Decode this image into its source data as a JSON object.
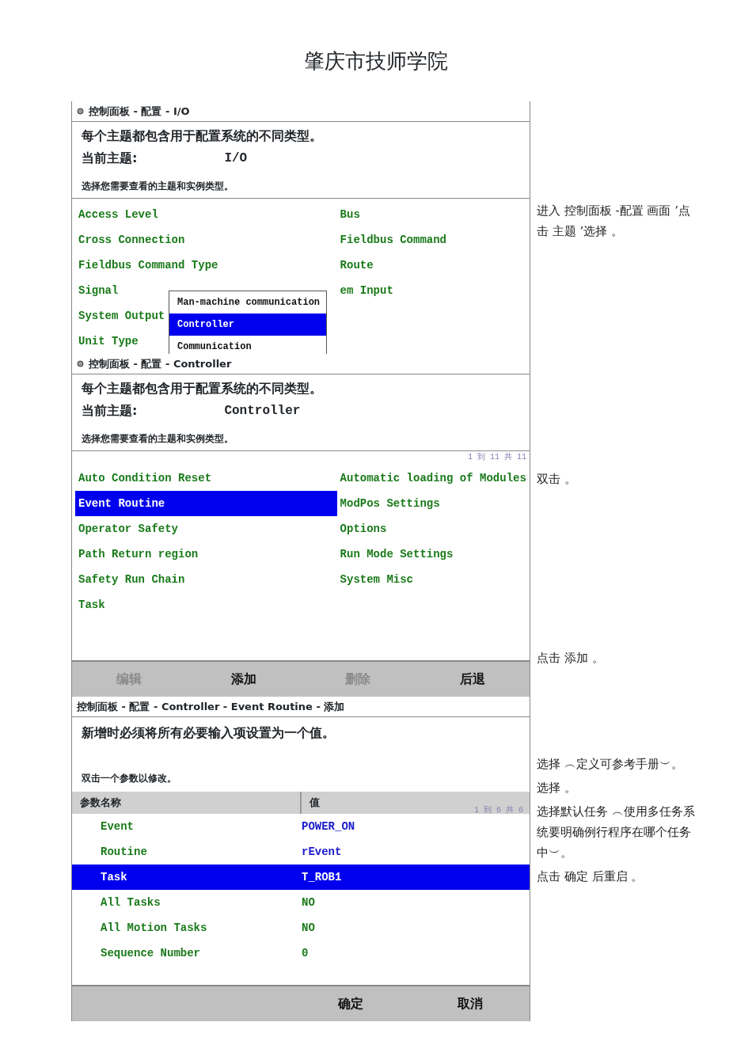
{
  "page_header": "肇庆市技师学院",
  "screens": [
    {
      "kind": "topics",
      "title": "控制面板 - 配置 - I/O",
      "intro": "每个主题都包含用于配置系统的不同类型。",
      "current_label": "当前主题:",
      "current_value": "I/O",
      "prompt": "选择您需要查看的主题和实例类型。",
      "columns": [
        [
          {
            "label": "Access Level",
            "selected": false
          },
          {
            "label": "Cross Connection",
            "selected": false
          },
          {
            "label": "Fieldbus Command Type",
            "selected": false
          },
          {
            "label": "Signal",
            "selected": false
          },
          {
            "label": "System Output",
            "selected": false
          },
          {
            "label": "Unit Type",
            "selected": false
          }
        ],
        [
          {
            "label": "Bus",
            "selected": false
          },
          {
            "label": "Fieldbus Command",
            "selected": false
          },
          {
            "label": "Route",
            "selected": false
          },
          {
            "label": "em Input",
            "selected": false
          }
        ]
      ],
      "popup": [
        {
          "label": "Man-machine communication",
          "selected": false
        },
        {
          "label": "Controller",
          "selected": true
        },
        {
          "label": "Communication",
          "selected": false
        }
      ],
      "notes": [
        "进入 控制面板 -配置 画面 ’点击 主题 ’选择 。"
      ]
    },
    {
      "kind": "topics",
      "title": "控制面板 - 配置 - Controller",
      "intro": "每个主题都包含用于配置系统的不同类型。",
      "current_label": "当前主题:",
      "current_value": "Controller",
      "prompt": "选择您需要查看的主题和实例类型。",
      "pagination": "1 到 11 共 11",
      "columns": [
        [
          {
            "label": "Auto Condition Reset",
            "selected": false
          },
          {
            "label": "Event Routine",
            "selected": true
          },
          {
            "label": "Operator Safety",
            "selected": false
          },
          {
            "label": "Path Return region",
            "selected": false
          },
          {
            "label": "Safety Run Chain",
            "selected": false
          },
          {
            "label": "Task",
            "selected": false
          }
        ],
        [
          {
            "label": "Automatic loading of Modules",
            "selected": false
          },
          {
            "label": "ModPos Settings",
            "selected": false
          },
          {
            "label": "Options",
            "selected": false
          },
          {
            "label": "Run Mode Settings",
            "selected": false
          },
          {
            "label": "System Misc",
            "selected": false
          }
        ]
      ],
      "toolbar": [
        {
          "label": "编辑",
          "disabled": true
        },
        {
          "label": "添加",
          "disabled": false
        },
        {
          "label": "删除",
          "disabled": true
        },
        {
          "label": "后退",
          "disabled": false
        }
      ],
      "notes": [
        "双击 。",
        "点击 添加 。"
      ]
    },
    {
      "kind": "form",
      "title": "控制面板 - 配置 - Controller - Event Routine - 添加",
      "intro": "新增时必须将所有必要输入项设置为一个值。",
      "prompt": "双击一个参数以修改。",
      "pagination": "1 到 6 共 6",
      "columns": [
        "参数名称",
        "值"
      ],
      "rows": [
        {
          "name": "Event",
          "value": "POWER_ON",
          "color": "#1a1acc",
          "selected": false
        },
        {
          "name": "Routine",
          "value": "rEvent",
          "color": "#1a1acc",
          "selected": false
        },
        {
          "name": "Task",
          "value": "T_ROB1",
          "selected": true
        },
        {
          "name": "All Tasks",
          "value": "NO",
          "color": "#1a7a1a",
          "selected": false
        },
        {
          "name": "All Motion Tasks",
          "value": "NO",
          "color": "#1a7a1a",
          "selected": false
        },
        {
          "name": "Sequence Number",
          "value": "0",
          "color": "#1a7a1a",
          "selected": false
        }
      ],
      "toolbar": [
        {
          "label": "确定",
          "disabled": false
        },
        {
          "label": "取消",
          "disabled": false
        }
      ],
      "notes": [
        "选择 ︵定义可参考手册︶。",
        "选择 。",
        "选择默认任务 ︵使用多任务系统要明确例行程序在哪个任务中︶。",
        "点击 确定 后重启 。"
      ]
    }
  ]
}
